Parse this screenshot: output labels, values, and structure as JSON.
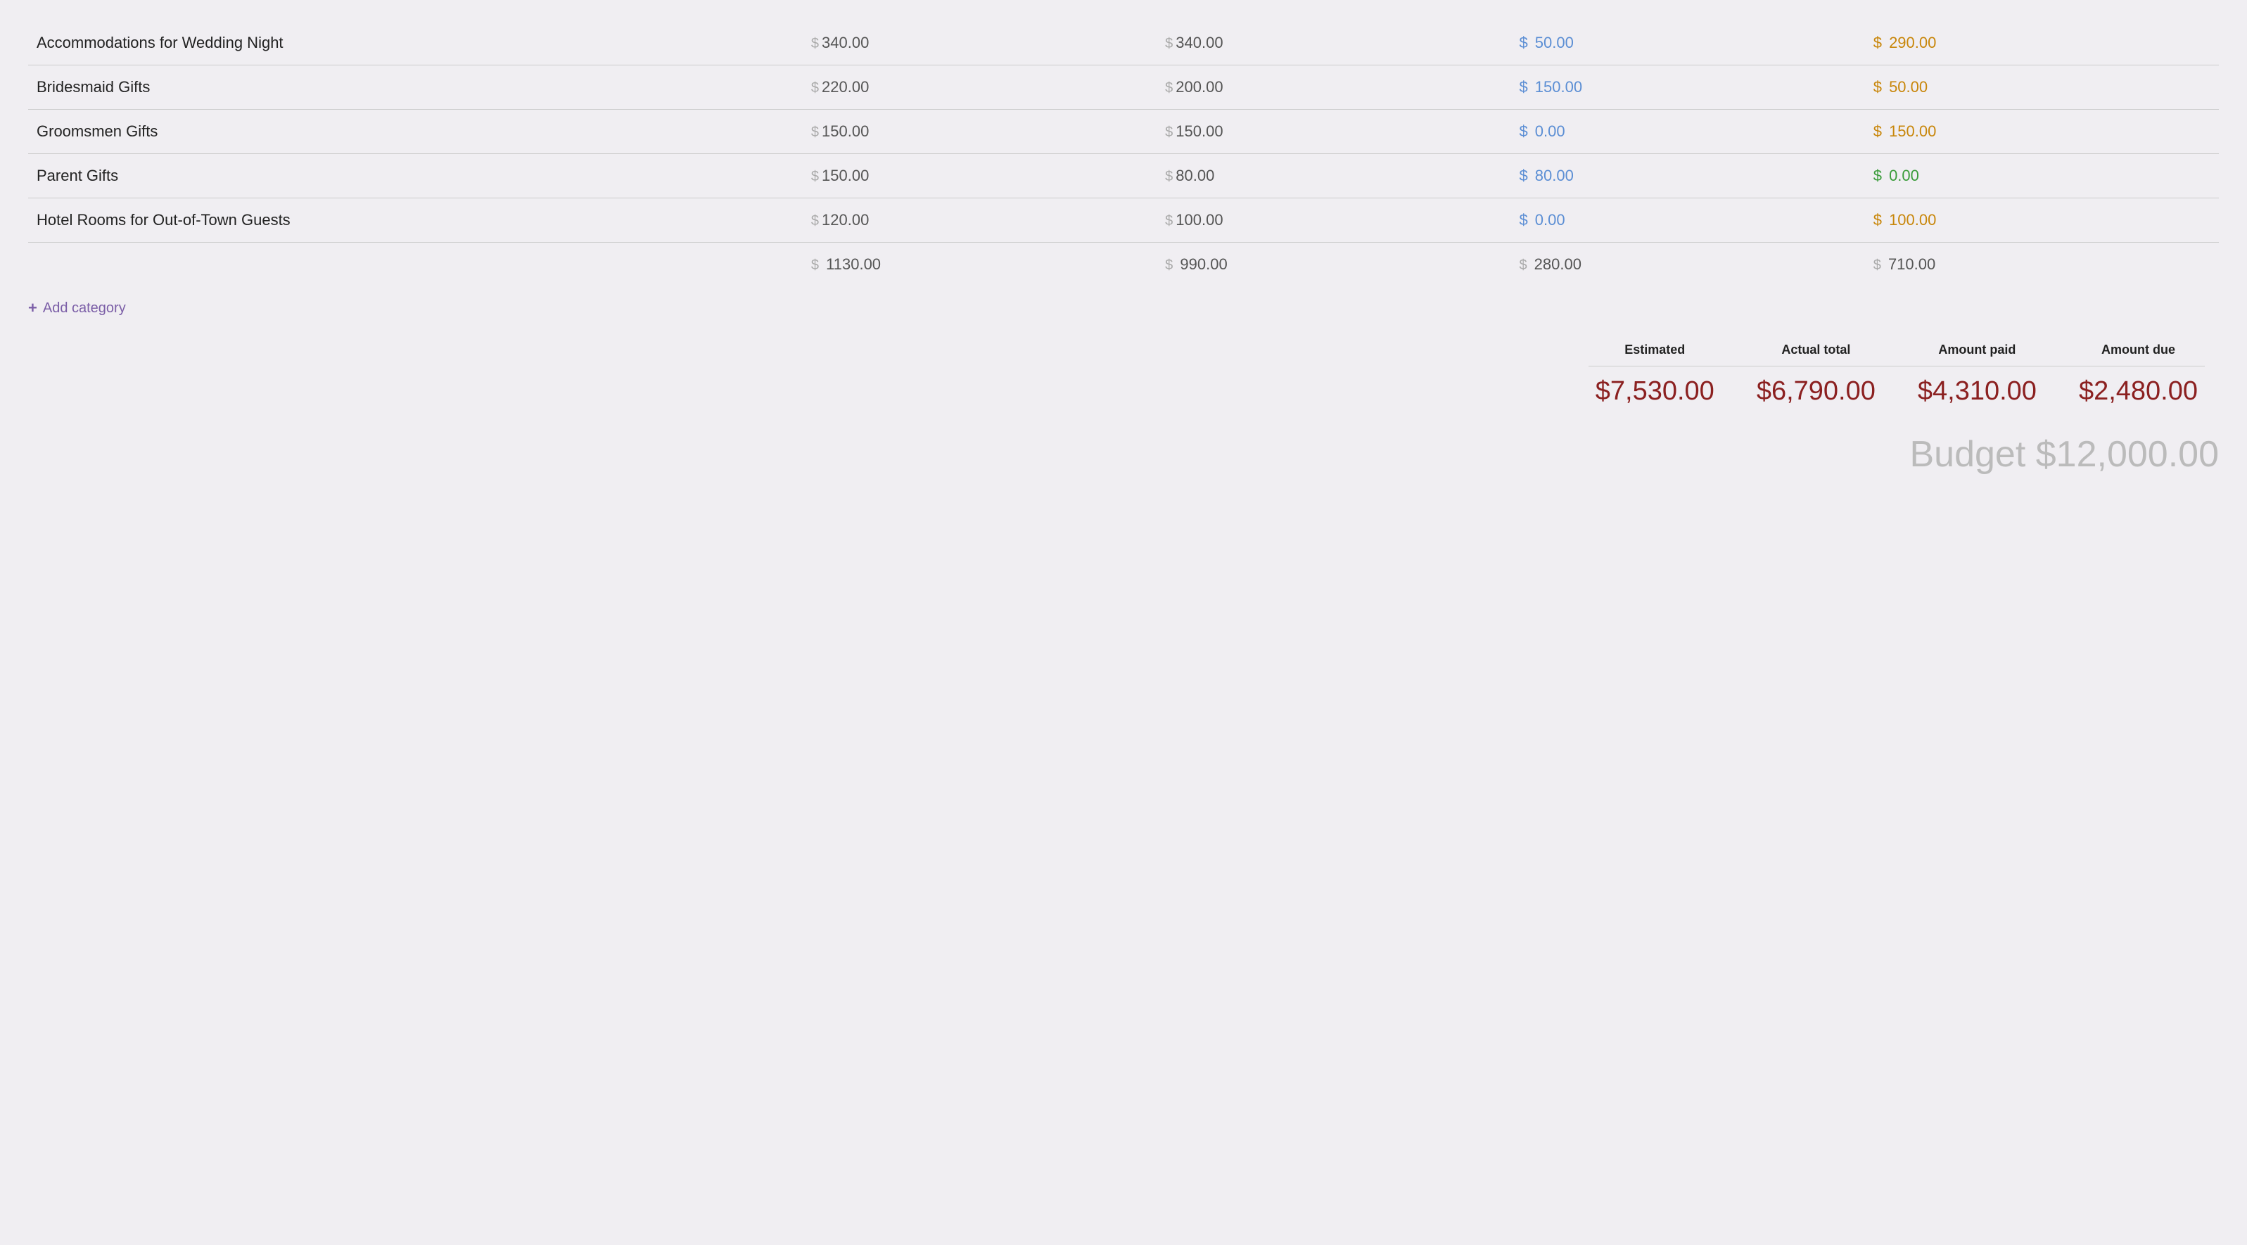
{
  "rows": [
    {
      "name": "Accommodations for Wedding Night",
      "estimated": "340.00",
      "actual": "340.00",
      "paid": "50.00",
      "due": "290.00",
      "due_color": "orange"
    },
    {
      "name": "Bridesmaid Gifts",
      "estimated": "220.00",
      "actual": "200.00",
      "paid": "150.00",
      "due": "50.00",
      "due_color": "orange"
    },
    {
      "name": "Groomsmen Gifts",
      "estimated": "150.00",
      "actual": "150.00",
      "paid": "0.00",
      "due": "150.00",
      "due_color": "orange"
    },
    {
      "name": "Parent Gifts",
      "estimated": "150.00",
      "actual": "80.00",
      "paid": "80.00",
      "due": "0.00",
      "due_color": "green"
    },
    {
      "name": "Hotel Rooms for Out-of-Town Guests",
      "estimated": "120.00",
      "actual": "100.00",
      "paid": "0.00",
      "due": "100.00",
      "due_color": "orange"
    }
  ],
  "subtotals": {
    "estimated": "1130.00",
    "actual": "990.00",
    "paid": "280.00",
    "due": "710.00"
  },
  "add_category_label": "Add category",
  "summary": {
    "columns": [
      {
        "label": "Estimated",
        "value": "$7,530.00"
      },
      {
        "label": "Actual total",
        "value": "$6,790.00"
      },
      {
        "label": "Amount paid",
        "value": "$4,310.00"
      },
      {
        "label": "Amount due",
        "value": "$2,480.00"
      }
    ]
  },
  "budget_label": "Budget $12,000.00",
  "currency_symbol": "$",
  "colors": {
    "orange": "#c8860a",
    "blue": "#5b8ed4",
    "green": "#3a9c3a",
    "muted": "#aaa",
    "dark_red": "#8b2020",
    "purple": "#7b5ea7"
  }
}
